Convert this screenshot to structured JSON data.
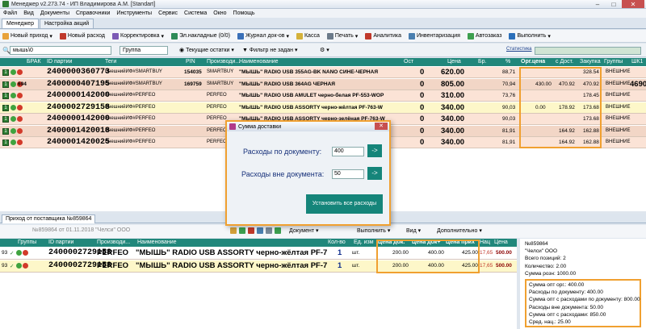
{
  "window": {
    "title": "Менеджер v2.273.74 - ИП Владимирова А.М. [Standart]"
  },
  "menu": [
    "Файл",
    "Вид",
    "Документы",
    "Справочники",
    "Инструменты",
    "Сервис",
    "Система",
    "Окно",
    "Помощь"
  ],
  "tabs": [
    "Менеджер",
    "Настройка акций"
  ],
  "toolbar": [
    "Новый приход",
    "Новый расход",
    "Корректировка",
    "Эл.накладные (0/0)",
    "Журнал док-ов",
    "Касса",
    "Печать",
    "Аналитика",
    "Инвентаризация",
    "Автозаказ",
    "Выполнить"
  ],
  "filter": {
    "search": "мышь\\0",
    "group": "Группа",
    "stock": "Текущие остатки",
    "filter_label": "Фильтр не задан",
    "stats_label": "Статистика"
  },
  "grid": {
    "headers": [
      "БРАК",
      "ID партии",
      "Теги",
      "PIN",
      "Производи...",
      "Наименование",
      "Ост",
      "Цена",
      "Бр.",
      "%",
      "Орг.цена",
      "с Дост.",
      "Закупка",
      "Группы",
      "ШК1"
    ],
    "rows": [
      {
        "id": "2400000360773",
        "tag": "ВнешнийИФ#SMARTBUY",
        "pin": "154035",
        "maker": "SMARTBUY",
        "name": "\"МЫШЬ\" RADIO USB 355AG-BK NANO СИНЕ-ЧЕРНАЯ",
        "qty": "0",
        "price": "620.00",
        "pct": "88,71",
        "org": "",
        "dost": "",
        "buy": "328.54",
        "grp": "ВНЕШНИЕ",
        "shk": "",
        "badge": ""
      },
      {
        "id": "2400000407195",
        "tag": "ВнешнийИФ#SMARTBUY",
        "pin": "169759",
        "maker": "SMARTBUY",
        "name": "\"МЫШЬ\" RADIO USB 364AG ЧЕРНАЯ",
        "qty": "0",
        "price": "805.00",
        "pct": "70,94",
        "org": "430.00",
        "dost": "470.92",
        "buy": "470.92",
        "grp": "ВНЕШНИЕ",
        "shk": "4690",
        "badge": "694"
      },
      {
        "id": "2400000142000",
        "tag": "ВнешнийИФ#PERFEO",
        "pin": "",
        "maker": "PERFEO",
        "name": "\"МЫШЬ\" RADIO USB AMULET черно-белая PF-553-WOP",
        "qty": "0",
        "price": "310.00",
        "pct": "73,76",
        "org": "",
        "dost": "",
        "buy": "178.45",
        "grp": "ВНЕШНИЕ",
        "shk": "",
        "badge": ""
      },
      {
        "id": "2400002729158",
        "tag": "ВнешнийИФ#PERFEO",
        "pin": "",
        "maker": "PERFEO",
        "name": "\"МЫШЬ\" RADIO USB ASSORTY черно-жёлтая PF-763-W",
        "qty": "0",
        "price": "340.00",
        "pct": "90,03",
        "org": "0.00",
        "dost": "178.92",
        "buy": "173.68",
        "grp": "ВНЕШНИЕ",
        "shk": "",
        "badge": ""
      },
      {
        "id": "2400000142000",
        "tag": "ВнешнийИФ#PERFEO",
        "pin": "",
        "maker": "PERFEO",
        "name": "\"МЫШЬ\" RADIO USB ASSORTY черно-зелёная PF-763-W",
        "qty": "0",
        "price": "340.00",
        "pct": "90,03",
        "org": "",
        "dost": "",
        "buy": "173.68",
        "grp": "ВНЕШНИЕ",
        "shk": "",
        "badge": ""
      },
      {
        "id": "2400001420018",
        "tag": "ВнешнийИФ#PERFEO",
        "pin": "",
        "maker": "PERFEO",
        "name": "\"МЫШЬ\" RADIO USB ASSORTY черно-синяя PF-763",
        "qty": "0",
        "price": "340.00",
        "pct": "81,91",
        "org": "",
        "dost": "164.92",
        "buy": "162.88",
        "grp": "ВНЕШНИЕ",
        "shk": "",
        "badge": ""
      },
      {
        "id": "2400001420025",
        "tag": "ВнешнийИФ#PERFEO",
        "pin": "",
        "maker": "PERFEO",
        "name": "\"МЫШЬ\" RADIO USB ASSORTY черно-красная PF-763",
        "qty": "0",
        "price": "340.00",
        "pct": "81,91",
        "org": "",
        "dost": "164.92",
        "buy": "162.88",
        "grp": "ВНЕШНИЕ",
        "shk": "",
        "badge": ""
      }
    ]
  },
  "dialog": {
    "title": "Сумма доставки",
    "label1": "Расходы по документу:",
    "value1": "400",
    "label2": "Расходы вне документа:",
    "value2": "50",
    "go": "->",
    "apply": "Установить все расходы"
  },
  "bottom": {
    "tab": "Приход от поставщика №859864",
    "doc": "№859864 от 01.11.2018 \"Челси\" ООО",
    "btn_doc": "Документ",
    "btn_exec": "Выполнить",
    "btn_view": "Вид",
    "btn_more": "Дополнительно",
    "headers": [
      "Группы",
      "ID партии",
      "Производи...",
      "Наименование",
      "Кол-во",
      "Ед. изм",
      "Цена док.",
      "Цена док+",
      "Цена прих",
      "Нац",
      "Цена"
    ],
    "rows": [
      {
        "num": "93",
        "id": "2400002729158",
        "maker": "PERFEO",
        "name": "\"МЫШЬ\" RADIO USB ASSORTY черно-жёлтая PF-7",
        "qty": "1",
        "unit": "шт.",
        "pdoc": "200.00",
        "pdocplus": "400.00",
        "pin": "425.00",
        "nac": "17,65",
        "price": "500.00"
      },
      {
        "num": "93",
        "id": "2400002729158",
        "maker": "PERFEO",
        "name": "\"МЫШЬ\" RADIO USB ASSORTY черно-жёлтая PF-7",
        "qty": "1",
        "unit": "шт.",
        "pdoc": "200.00",
        "pdocplus": "400.00",
        "pin": "425.00",
        "nac": "17,65",
        "price": "500.00"
      }
    ]
  },
  "side": {
    "lines1": [
      "№859864",
      "\"Челси\" ООО",
      "Всего позиций: 2",
      "Количество: 2.00",
      "Сумма розн: 1000.00"
    ],
    "lines2": [
      "Сумма опт орг.: 400.00",
      "Расходы по документу: 400.00",
      "Сумма опт с расходами по документу: 800.00",
      "Расходы вне документа: 50.00",
      "Сумма опт с расходами: 850.00",
      "Сред. нац.: 25.00"
    ]
  }
}
